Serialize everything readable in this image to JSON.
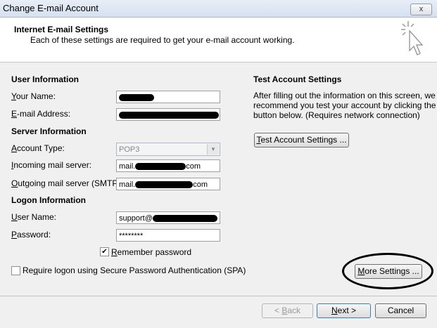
{
  "window": {
    "title": "Change E-mail Account",
    "close_label": "x"
  },
  "header": {
    "title": "Internet E-mail Settings",
    "subtitle": "Each of these settings are required to get your e-mail account working."
  },
  "user_info": {
    "heading": "User Information",
    "name_label_u": "Y",
    "name_label_rest": "our Name:",
    "email_label_u": "E",
    "email_label_rest": "-mail Address:"
  },
  "server_info": {
    "heading": "Server Information",
    "account_type_label_u": "A",
    "account_type_label_rest": "ccount Type:",
    "account_type_value": "POP3",
    "incoming_label_u": "I",
    "incoming_label_rest": "ncoming mail server:",
    "incoming_prefix": "mail.",
    "incoming_suffix": "com",
    "outgoing_label_u": "O",
    "outgoing_label_rest": "utgoing mail server (SMTP):",
    "outgoing_prefix": "mail.",
    "outgoing_suffix": "com"
  },
  "logon_info": {
    "heading": "Logon Information",
    "username_label_u": "U",
    "username_label_rest": "ser Name:",
    "username_prefix": "support@",
    "password_label_u": "P",
    "password_label_rest": "assword:",
    "password_value": "********",
    "remember_label_u": "R",
    "remember_label_rest": "emember password",
    "remember_checked": true,
    "spa_label_u": "q",
    "spa_label_pre": "Re",
    "spa_label_rest": "uire logon using Secure Password Authentication (SPA)",
    "spa_checked": false
  },
  "test_settings": {
    "heading": "Test Account Settings",
    "description_line1": "After filling out the information on this screen, we",
    "description_line2": "recommend you test your account by clicking the",
    "description_line3": "button below. (Requires network connection)",
    "button_u": "T",
    "button_rest": "est Account Settings ..."
  },
  "more_settings": {
    "label_u": "M",
    "label_rest": "ore Settings ..."
  },
  "footer": {
    "back_pre": "< ",
    "back_u": "B",
    "back_rest": "ack",
    "next_u": "N",
    "next_rest": "ext >",
    "cancel_label": "Cancel"
  }
}
